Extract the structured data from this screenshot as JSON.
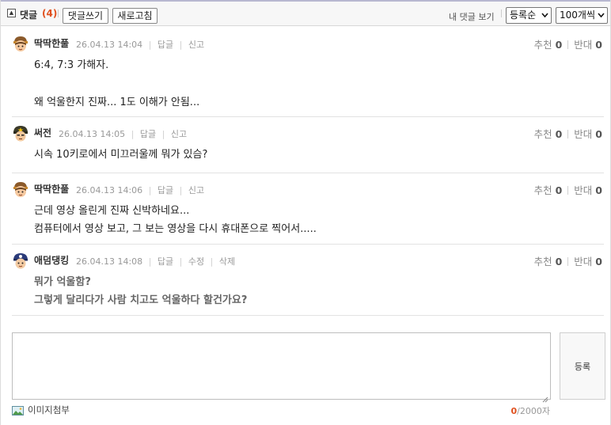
{
  "header": {
    "toggle_icon": "collapse-square-icon",
    "comments_label": "댓글",
    "comments_count": "(4)",
    "write_button": "댓글쓰기",
    "refresh_button": "새로고침",
    "my_comments_link": "내 댓글 보기",
    "sort_select": "등록순",
    "page_size_select": "100개씩"
  },
  "comments": [
    {
      "nickname": "딱딱한풀",
      "date": "26.04.13 14:04",
      "actions": [
        "답글",
        "신고"
      ],
      "upvote_label": "추천",
      "upvote_count": "0",
      "downvote_label": "반대",
      "downvote_count": "0",
      "lines": [
        "6:4, 7:3 가해자.",
        "",
        "왜 억울한지 진짜... 1도 이해가 안됨..."
      ]
    },
    {
      "nickname": "써전",
      "date": "26.04.13 14:05",
      "actions": [
        "답글",
        "신고"
      ],
      "upvote_label": "추천",
      "upvote_count": "0",
      "downvote_label": "반대",
      "downvote_count": "0",
      "lines": [
        "시속 10키로에서 미끄러울께 뭐가 있슴?"
      ]
    },
    {
      "nickname": "딱딱한풀",
      "date": "26.04.13 14:06",
      "actions": [
        "답글",
        "신고"
      ],
      "upvote_label": "추천",
      "upvote_count": "0",
      "downvote_label": "반대",
      "downvote_count": "0",
      "lines": [
        "근데 영상 올린게 진짜 신박하네요...",
        "컴퓨터에서 영상 보고, 그 보는 영상을 다시 휴대폰으로 찍어서....."
      ]
    },
    {
      "nickname": "애덤댕킹",
      "date": "26.04.13 14:08",
      "actions": [
        "답글",
        "수정",
        "삭제"
      ],
      "upvote_label": "추천",
      "upvote_count": "0",
      "downvote_label": "반대",
      "downvote_count": "0",
      "lines": [
        "뭐가 억울함?",
        "그렇게 달리다가 사람 치고도 억울하다 할건가요?"
      ]
    }
  ],
  "editor": {
    "text": "",
    "submit_button": "등록",
    "attach_label": "이미지첨부",
    "attach_icon": "image-icon",
    "char_current": "0",
    "char_limit": "/2000자"
  },
  "colors": {
    "accent": "#e0501f",
    "header_bg": "#f7f7f7",
    "meta_text": "#999999"
  }
}
